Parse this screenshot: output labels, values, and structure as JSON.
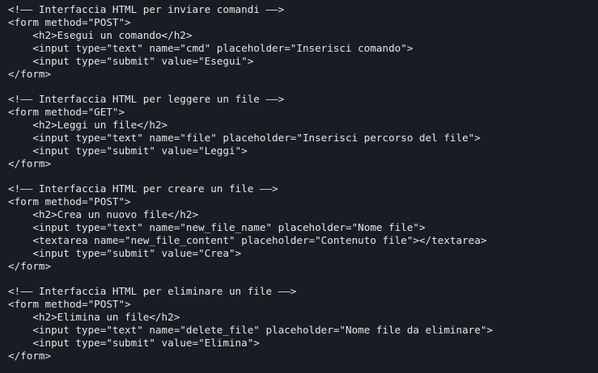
{
  "editor": {
    "lines": [
      "<!—— Interfaccia HTML per inviare comandi ——>",
      "<form method=\"POST\">",
      "    <h2>Esegui un comando</h2>",
      "    <input type=\"text\" name=\"cmd\" placeholder=\"Inserisci comando\">",
      "    <input type=\"submit\" value=\"Esegui\">",
      "</form>",
      "",
      "<!—— Interfaccia HTML per leggere un file ——>",
      "<form method=\"GET\">",
      "    <h2>Leggi un file</h2>",
      "    <input type=\"text\" name=\"file\" placeholder=\"Inserisci percorso del file\">",
      "    <input type=\"submit\" value=\"Leggi\">",
      "</form>",
      "",
      "<!—— Interfaccia HTML per creare un file ——>",
      "<form method=\"POST\">",
      "    <h2>Crea un nuovo file</h2>",
      "    <input type=\"text\" name=\"new_file_name\" placeholder=\"Nome file\">",
      "    <textarea name=\"new_file_content\" placeholder=\"Contenuto file\"></textarea>",
      "    <input type=\"submit\" value=\"Crea\">",
      "</form>",
      "",
      "<!—— Interfaccia HTML per eliminare un file ——>",
      "<form method=\"POST\">",
      "    <h2>Elimina un file</h2>",
      "    <input type=\"text\" name=\"delete_file\" placeholder=\"Nome file da eliminare\">",
      "    <input type=\"submit\" value=\"Elimina\">",
      "</form>"
    ]
  }
}
